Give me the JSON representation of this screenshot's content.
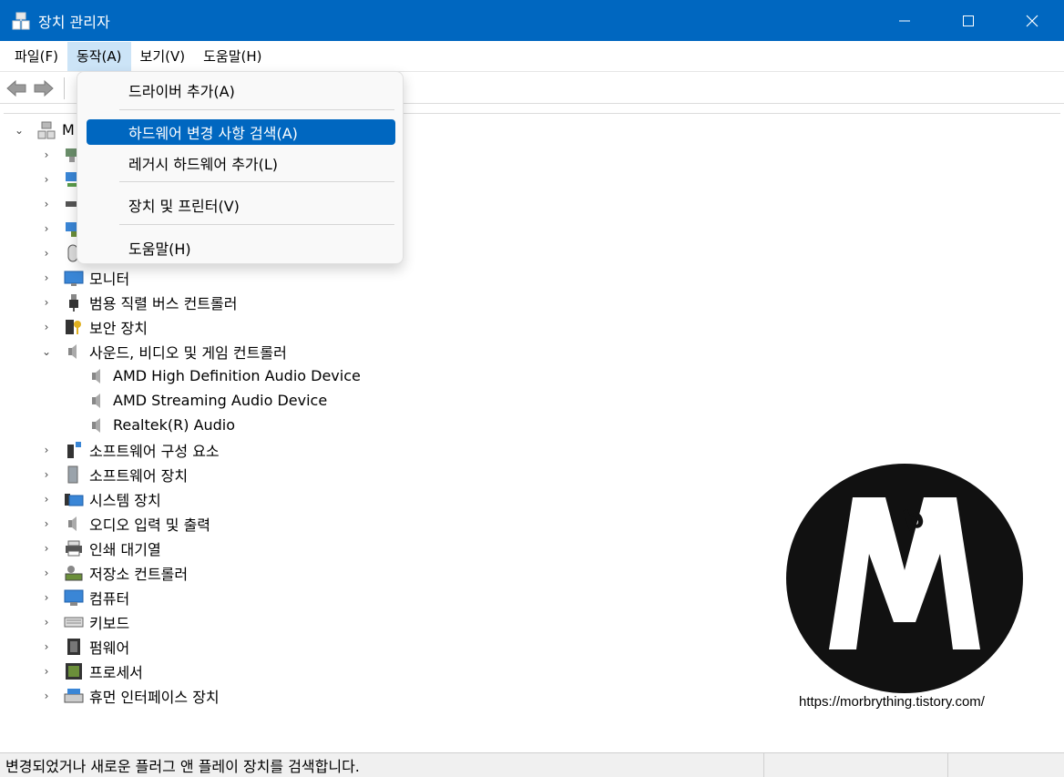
{
  "window": {
    "title": "장치 관리자",
    "minimize_icon": "minimize-icon",
    "maximize_icon": "maximize-icon",
    "close_icon": "close-icon"
  },
  "menubar": {
    "items": [
      "파일(F)",
      "동작(A)",
      "보기(V)",
      "도움말(H)"
    ],
    "active_index": 1
  },
  "toolbar": {
    "back_icon": "back-arrow-icon",
    "forward_icon": "forward-arrow-icon"
  },
  "dropdown": {
    "items": [
      "드라이버 추가(A)",
      "하드웨어 변경 사항 검색(A)",
      "레거시 하드웨어 추가(L)",
      "장치 및 프린터(V)",
      "도움말(H)"
    ],
    "highlighted_index": 1
  },
  "tree": {
    "root_label": "M",
    "nodes": [
      {
        "label": "모니터",
        "icon": "monitor-icon"
      },
      {
        "label": "범용 직렬 버스 컨트롤러",
        "icon": "usb-icon"
      },
      {
        "label": "보안 장치",
        "icon": "security-device-icon"
      },
      {
        "label": "사운드, 비디오 및 게임 컨트롤러",
        "icon": "speaker-icon",
        "expanded": true
      },
      {
        "label": "AMD High Definition Audio Device",
        "icon": "speaker-icon"
      },
      {
        "label": "AMD Streaming Audio Device",
        "icon": "speaker-icon"
      },
      {
        "label": "Realtek(R) Audio",
        "icon": "speaker-icon"
      },
      {
        "label": "소프트웨어 구성 요소",
        "icon": "software-component-icon"
      },
      {
        "label": "소프트웨어 장치",
        "icon": "software-device-icon"
      },
      {
        "label": "시스템 장치",
        "icon": "system-device-icon"
      },
      {
        "label": "오디오 입력 및 출력",
        "icon": "speaker-icon"
      },
      {
        "label": "인쇄 대기열",
        "icon": "printer-icon"
      },
      {
        "label": "저장소 컨트롤러",
        "icon": "storage-controller-icon"
      },
      {
        "label": "컴퓨터",
        "icon": "computer-icon"
      },
      {
        "label": "키보드",
        "icon": "keyboard-icon"
      },
      {
        "label": "펌웨어",
        "icon": "firmware-icon"
      },
      {
        "label": "프로세서",
        "icon": "processor-icon"
      },
      {
        "label": "휴먼 인터페이스 장치",
        "icon": "hid-icon"
      }
    ]
  },
  "statusbar": {
    "text": "변경되었거나 새로운 플러그 앤 플레이 장치를 검색합니다."
  },
  "watermark": {
    "url": "https://morbrything.tistory.com/",
    "logo_letter": "M",
    "logo_small_letter": "b"
  }
}
